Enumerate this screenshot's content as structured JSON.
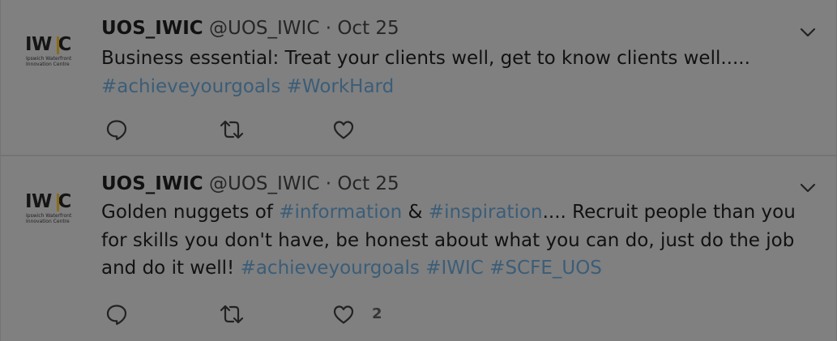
{
  "colors": {
    "background": "#808080",
    "hashtag": "#3b5d78",
    "text": "#111111",
    "muted": "#262626"
  },
  "tweets": [
    {
      "avatar": {
        "logo_text": "IW|C",
        "logo_line1": "Ipswich Waterfront",
        "logo_line2": "Innovation Centre"
      },
      "name": "UOS_IWIC",
      "handle": "@UOS_IWIC",
      "separator": "·",
      "date": "Oct 25",
      "caret_icon": "chevron-down-icon",
      "text": {
        "line1": "Business essential: Treat your clients well, get to know clients well.....",
        "hashtag1": "#achieveyourgoals",
        "hashtag2": "#WorkHard"
      },
      "actions": {
        "reply_icon": "reply-icon",
        "retweet_icon": "retweet-icon",
        "like_icon": "heart-icon",
        "like_count": ""
      }
    },
    {
      "avatar": {
        "logo_text": "IW|C",
        "logo_line1": "Ipswich Waterfront",
        "logo_line2": "Innovation Centre"
      },
      "name": "UOS_IWIC",
      "handle": "@UOS_IWIC",
      "separator": "·",
      "date": "Oct 25",
      "caret_icon": "chevron-down-icon",
      "text": {
        "part1": "Golden nuggets of ",
        "hashtag1": "#information",
        "part2": " & ",
        "hashtag2": "#inspiration",
        "part3": ".... Recruit people than you for skills you don't have, be honest about what you can do, just do the job and do it well! ",
        "hashtag3": "#achieveyourgoals",
        "space1": " ",
        "hashtag4": "#IWIC",
        "space2": " ",
        "hashtag5": "#SCFE_UOS"
      },
      "actions": {
        "reply_icon": "reply-icon",
        "retweet_icon": "retweet-icon",
        "like_icon": "heart-icon",
        "like_count": "2"
      }
    }
  ]
}
